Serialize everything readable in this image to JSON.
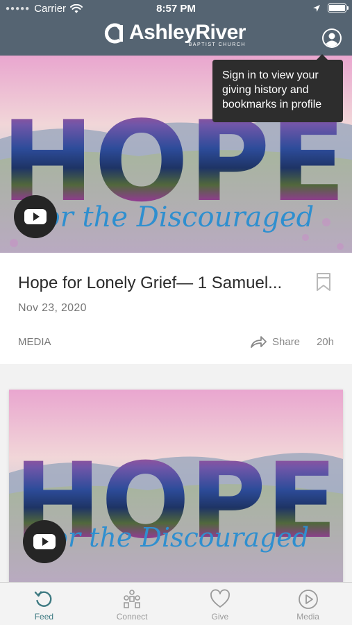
{
  "status_bar": {
    "carrier": "Carrier",
    "time": "8:57 PM"
  },
  "header": {
    "brand_name": "AshleyRiver",
    "brand_sub": "BAPTIST CHURCH"
  },
  "tooltip": {
    "text": "Sign in to view your giving history and bookmarks in profile"
  },
  "feed": {
    "items": [
      {
        "image_title": "HOPE",
        "image_subtitle": "for the Discouraged",
        "title": "Hope for Lonely Grief— 1 Samuel...",
        "date": "Nov 23, 2020",
        "category": "MEDIA",
        "share_label": "Share",
        "time_ago": "20h"
      },
      {
        "image_title": "HOPE",
        "image_subtitle": "for the Discouraged"
      }
    ]
  },
  "tabbar": {
    "tabs": [
      {
        "label": "Feed",
        "icon": "feed-icon",
        "active": true
      },
      {
        "label": "Connect",
        "icon": "connect-icon",
        "active": false
      },
      {
        "label": "Give",
        "icon": "heart-icon",
        "active": false
      },
      {
        "label": "Media",
        "icon": "play-circle-icon",
        "active": false
      }
    ]
  },
  "colors": {
    "header_bg": "#556472",
    "accent": "#3e7a82",
    "tooltip_bg": "#2d2d2d"
  }
}
